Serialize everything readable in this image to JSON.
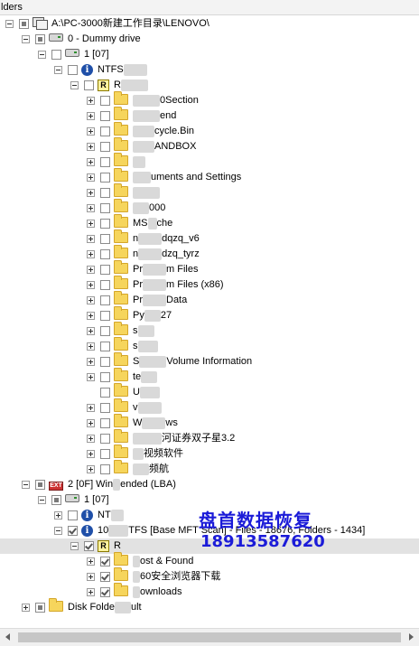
{
  "panel": {
    "title": "lders"
  },
  "tree": [
    {
      "indent": 0,
      "expander": "minus",
      "check": "none",
      "icon": "root",
      "label": "A:\\PC-3000新建工作目录\\LENOVO\\"
    },
    {
      "indent": 1,
      "expander": "minus",
      "check": "partial",
      "icon": "drive",
      "label": "0 - Dummy drive"
    },
    {
      "indent": 2,
      "expander": "minus",
      "check": "empty",
      "icon": "drive",
      "label": "1 [07]"
    },
    {
      "indent": 3,
      "expander": "minus",
      "check": "empty",
      "icon": "info",
      "label": "NTFS",
      "blur_after": 26
    },
    {
      "indent": 4,
      "expander": "minus",
      "check": "empty",
      "icon": "r",
      "label": "R",
      "blur_after": 30
    },
    {
      "indent": 5,
      "expander": "plus",
      "check": "empty",
      "icon": "folder",
      "blur_before": 30,
      "label": "0Section"
    },
    {
      "indent": 5,
      "expander": "plus",
      "check": "empty",
      "icon": "folder",
      "blur_before": 30,
      "label": "end"
    },
    {
      "indent": 5,
      "expander": "plus",
      "check": "empty",
      "icon": "folder",
      "blur_before": 24,
      "label": "cycle.Bin"
    },
    {
      "indent": 5,
      "expander": "plus",
      "check": "empty",
      "icon": "folder",
      "blur_before": 24,
      "label": "ANDBOX"
    },
    {
      "indent": 5,
      "expander": "plus",
      "check": "empty",
      "icon": "folder",
      "blur_before": 14,
      "label": ""
    },
    {
      "indent": 5,
      "expander": "plus",
      "check": "empty",
      "icon": "folder",
      "blur_before": 20,
      "label": "uments and Settings"
    },
    {
      "indent": 5,
      "expander": "plus",
      "check": "empty",
      "icon": "folder",
      "blur_before": 30,
      "label": ""
    },
    {
      "indent": 5,
      "expander": "plus",
      "check": "empty",
      "icon": "folder",
      "blur_before": 18,
      "label": "000"
    },
    {
      "indent": 5,
      "expander": "plus",
      "check": "empty",
      "icon": "folder",
      "blur_before": 0,
      "label": "MS",
      "blur_after": 10,
      "label2": "che"
    },
    {
      "indent": 5,
      "expander": "plus",
      "check": "empty",
      "icon": "folder",
      "blur_before": 0,
      "label": "n",
      "blur_after": 26,
      "label2": "dqzq_v6"
    },
    {
      "indent": 5,
      "expander": "plus",
      "check": "empty",
      "icon": "folder",
      "blur_before": 0,
      "label": "n",
      "blur_after": 26,
      "label2": "dzq_tyrz"
    },
    {
      "indent": 5,
      "expander": "plus",
      "check": "empty",
      "icon": "folder",
      "blur_before": 0,
      "label": "Pr",
      "blur_after": 26,
      "label2": "m Files"
    },
    {
      "indent": 5,
      "expander": "plus",
      "check": "empty",
      "icon": "folder",
      "blur_before": 0,
      "label": "Pr",
      "blur_after": 26,
      "label2": "m Files (x86)"
    },
    {
      "indent": 5,
      "expander": "plus",
      "check": "empty",
      "icon": "folder",
      "blur_before": 0,
      "label": "Pr",
      "blur_after": 26,
      "label2": "Data"
    },
    {
      "indent": 5,
      "expander": "plus",
      "check": "empty",
      "icon": "folder",
      "blur_before": 0,
      "label": "Py",
      "blur_after": 18,
      "label2": "27"
    },
    {
      "indent": 5,
      "expander": "plus",
      "check": "empty",
      "icon": "folder",
      "blur_before": 0,
      "label": "s",
      "blur_after": 18,
      "label2": ""
    },
    {
      "indent": 5,
      "expander": "plus",
      "check": "empty",
      "icon": "folder",
      "blur_before": 0,
      "label": "s",
      "blur_after": 22,
      "label2": ""
    },
    {
      "indent": 5,
      "expander": "plus",
      "check": "empty",
      "icon": "folder",
      "blur_before": 0,
      "label": "S",
      "blur_after": 30,
      "label2": "Volume Information"
    },
    {
      "indent": 5,
      "expander": "plus",
      "check": "empty",
      "icon": "folder",
      "blur_before": 0,
      "label": "te",
      "blur_after": 18,
      "label2": ""
    },
    {
      "indent": 5,
      "expander": "none",
      "check": "empty",
      "icon": "folder",
      "blur_before": 0,
      "label": "U",
      "blur_after": 22,
      "label2": ""
    },
    {
      "indent": 5,
      "expander": "plus",
      "check": "empty",
      "icon": "folder",
      "blur_before": 0,
      "label": "v",
      "blur_after": 26,
      "label2": ""
    },
    {
      "indent": 5,
      "expander": "plus",
      "check": "empty",
      "icon": "folder",
      "blur_before": 0,
      "label": "W",
      "blur_after": 26,
      "label2": "ws"
    },
    {
      "indent": 5,
      "expander": "plus",
      "check": "empty",
      "icon": "folder",
      "blur_before": 32,
      "label": "河证券双子星3.2"
    },
    {
      "indent": 5,
      "expander": "plus",
      "check": "empty",
      "icon": "folder",
      "blur_before": 12,
      "label": "视频软件"
    },
    {
      "indent": 5,
      "expander": "plus",
      "check": "empty",
      "icon": "folder",
      "blur_before": 18,
      "label": "频航"
    },
    {
      "indent": 1,
      "expander": "minus",
      "check": "partial",
      "icon": "ext",
      "label": "2 [0F] Win",
      "blur_after": 8,
      "label2": "ended  (LBA)"
    },
    {
      "indent": 2,
      "expander": "minus",
      "check": "partial",
      "icon": "drive",
      "label": "1 [07]"
    },
    {
      "indent": 3,
      "expander": "plus",
      "check": "empty",
      "icon": "info",
      "label": "NT",
      "blur_after": 14,
      "label2": ""
    },
    {
      "indent": 3,
      "expander": "minus",
      "check": "checked",
      "icon": "info",
      "label": "10",
      "blur_after": 22,
      "label2": "TFS [Base MFT Scan] - Files - 18676, Folders - 1434]"
    },
    {
      "indent": 4,
      "expander": "minus",
      "check": "checked",
      "icon": "r",
      "label": "R",
      "blur_after": 0,
      "selected": true
    },
    {
      "indent": 5,
      "expander": "plus",
      "check": "checked",
      "icon": "folder",
      "blur_before": 8,
      "label": "ost & Found"
    },
    {
      "indent": 5,
      "expander": "plus",
      "check": "checked",
      "icon": "folder",
      "blur_before": 8,
      "label": "60安全浏览器下载"
    },
    {
      "indent": 5,
      "expander": "plus",
      "check": "checked",
      "icon": "folder",
      "blur_before": 8,
      "label": "ownloads"
    },
    {
      "indent": 1,
      "expander": "plus",
      "check": "partial",
      "icon": "folder",
      "label": "Disk Folde",
      "blur_after": 18,
      "label2": "ult"
    }
  ],
  "watermark": {
    "text": "盘首数据恢复",
    "phone": "18913587620"
  }
}
